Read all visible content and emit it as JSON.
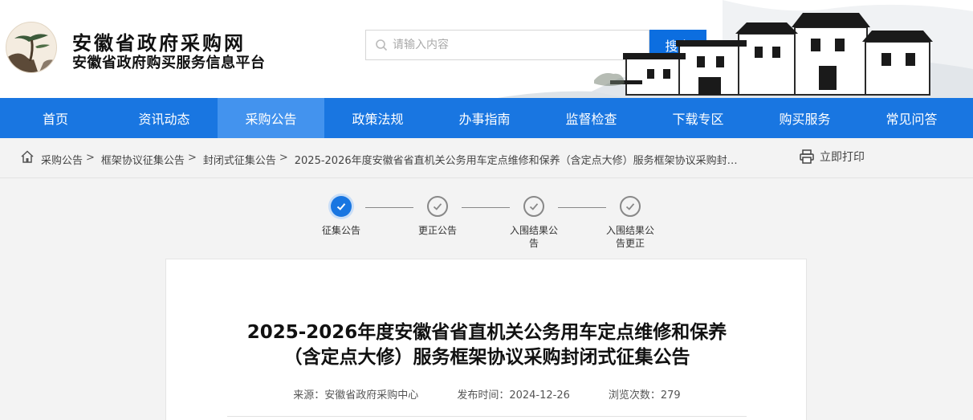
{
  "header": {
    "site_name": "安徽省政府采购网",
    "site_subtitle": "安徽省政府购买服务信息平台",
    "search_placeholder": "请输入内容",
    "search_button": "搜索"
  },
  "nav": {
    "items": [
      "首页",
      "资讯动态",
      "采购公告",
      "政策法规",
      "办事指南",
      "监督检查",
      "下载专区",
      "购买服务",
      "常见问答"
    ],
    "active_index": 2
  },
  "breadcrumb": {
    "items": [
      "采购公告",
      "框架协议征集公告",
      "封闭式征集公告",
      "2025-2026年度安徽省省直机关公务用车定点维修和保养（含定点大修）服务框架协议采购封…"
    ],
    "separator": ">",
    "print_label": "立即打印"
  },
  "steps": [
    {
      "label": "征集公告",
      "done": true
    },
    {
      "label": "更正公告",
      "done": false
    },
    {
      "label": "入围结果公告",
      "done": false
    },
    {
      "label": "入围结果公告更正",
      "done": false
    }
  ],
  "article": {
    "title_line1": "2025-2026年度安徽省省直机关公务用车定点维修和保养",
    "title_line2": "（含定点大修）服务框架协议采购封闭式征集公告",
    "source": "来源：安徽省政府采购中心",
    "publish_time": "发布时间：2024-12-26",
    "views": "浏览次数：279"
  },
  "colors": {
    "nav_bg": "#1976e1",
    "nav_active": "#4393ee",
    "search_button": "#0c6ee0"
  }
}
